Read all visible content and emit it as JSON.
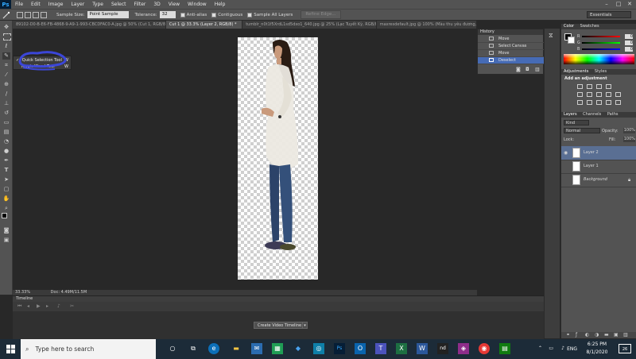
{
  "app": {
    "logo": "Ps"
  },
  "menu": [
    "File",
    "Edit",
    "Image",
    "Layer",
    "Type",
    "Select",
    "Filter",
    "3D",
    "View",
    "Window",
    "Help"
  ],
  "window_controls": {
    "minimize": "–",
    "maximize": "□",
    "close": "✕"
  },
  "options_bar": {
    "sample_size_label": "Sample Size:",
    "sample_size_value": "Point Sample",
    "tolerance_label": "Tolerance:",
    "tolerance_value": "32",
    "antialias_label": "Anti-alias",
    "contiguous_label": "Contiguous",
    "sample_all_layers_label": "Sample All Layers",
    "refine_edge_label": "Refine Edge..."
  },
  "workspace": "Essentials",
  "tabs": [
    {
      "label": "89102-D0-B-E6-FB-4868-9-A9-1-993-CBCDFAC0-A.jpg @ 50% (Cut 1, RGB/8) *",
      "active": false
    },
    {
      "label": "Cut 1 @ 33.3% (Layer 2, RGB/8) *",
      "active": true
    },
    {
      "label": "tumblr_n0t1f5XrdL1sd5dxo1_640.jpg @ 25% (Lạc Tuyết Kỳ, RGB/8) *",
      "active": false
    },
    {
      "label": "maxresdefault.jpg @ 100% (Màu thu yêu đương, RGB/8) *",
      "active": false
    }
  ],
  "tool_flyout": {
    "items": [
      {
        "label": "Quick Selection Tool",
        "key": "W",
        "selected": true
      },
      {
        "label": "Magic Wand Tool",
        "key": "W",
        "selected": false
      }
    ]
  },
  "history": {
    "title": "History",
    "items": [
      {
        "label": "Move",
        "selected": false
      },
      {
        "label": "Select Canvas",
        "selected": false
      },
      {
        "label": "Move",
        "selected": false
      },
      {
        "label": "Deselect",
        "selected": true
      }
    ]
  },
  "color_panel": {
    "tabs": [
      "Color",
      "Swatches"
    ],
    "channels": [
      {
        "label": "R",
        "value": "0",
        "color": "#ff0000"
      },
      {
        "label": "G",
        "value": "0",
        "color": "#00ff00"
      },
      {
        "label": "B",
        "value": "0",
        "color": "#0000ff"
      }
    ]
  },
  "adjustments_panel": {
    "tabs": [
      "Adjustments",
      "Styles"
    ],
    "heading": "Add an adjustment"
  },
  "layers_panel": {
    "tabs": [
      "Layers",
      "Channels",
      "Paths"
    ],
    "filter_kind": "Kind",
    "blend_mode": "Normal",
    "opacity_label": "Opacity:",
    "opacity_value": "100%",
    "lock_label": "Lock:",
    "fill_label": "Fill:",
    "fill_value": "100%",
    "layers": [
      {
        "name": "Layer 2",
        "selected": true
      },
      {
        "name": "Layer 1",
        "selected": false
      },
      {
        "name": "Background",
        "selected": false,
        "locked": true
      }
    ]
  },
  "status": {
    "zoom": "33.33%",
    "doc": "Doc: 4.49M/11.5M"
  },
  "timeline": {
    "title": "Timeline",
    "create_button": "Create Video Timeline"
  },
  "taskbar": {
    "search_placeholder": "Type here to search",
    "language": "ENG",
    "time": "6:25 PM",
    "date": "8/1/2020",
    "notification_count": "26"
  }
}
